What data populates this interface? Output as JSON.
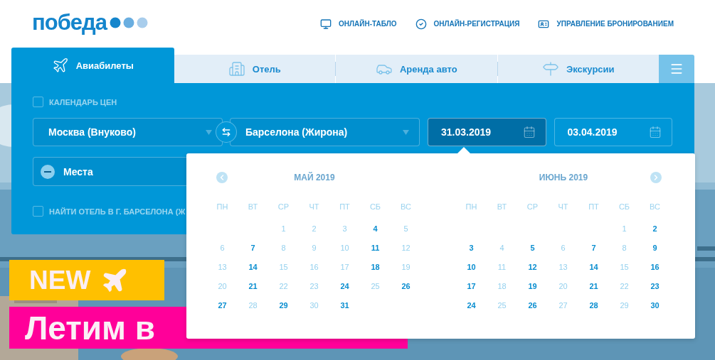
{
  "logo": {
    "text": "победа"
  },
  "nav": [
    {
      "label": "ОНЛАЙН-ТАБЛО"
    },
    {
      "label": "ОНЛАЙН-РЕГИСТРАЦИЯ"
    },
    {
      "label": "УПРАВЛЕНИЕ БРОНИРОВАНИЕМ"
    }
  ],
  "tabs": [
    {
      "label": "Авиабилеты",
      "selected": true
    },
    {
      "label": "Отель",
      "selected": false
    },
    {
      "label": "Аренда авто",
      "selected": false
    },
    {
      "label": "Экскурсии",
      "selected": false
    }
  ],
  "form": {
    "price_calendar": {
      "label": "КАЛЕНДАРЬ ЦЕН",
      "checked": false
    },
    "from": {
      "value": "Москва (Внуково)"
    },
    "to": {
      "value": "Барселона (Жирона)"
    },
    "dates": [
      {
        "value": "31.03.2019",
        "selected": true
      },
      {
        "value": "03.04.2019",
        "selected": false
      }
    ],
    "passengers": {
      "label": "Места"
    },
    "hotel": {
      "label": "НАЙТИ ОТЕЛЬ В Г. БАРСЕЛОНА (Ж",
      "checked": false
    }
  },
  "calendar": {
    "months": [
      {
        "title": "МАЙ 2019",
        "weekdays": [
          "ПН",
          "ВТ",
          "СР",
          "ЧТ",
          "ПТ",
          "СБ",
          "ВС"
        ],
        "weeks": [
          [
            {
              "kind": "blank"
            },
            {
              "kind": "blank"
            },
            {
              "kind": "day",
              "label": "1",
              "available": false
            },
            {
              "kind": "day",
              "label": "2",
              "available": false
            },
            {
              "kind": "day",
              "label": "3",
              "available": false
            },
            {
              "kind": "day",
              "label": "4",
              "available": true
            },
            {
              "kind": "day",
              "label": "5",
              "available": false
            }
          ],
          [
            {
              "kind": "day",
              "label": "6",
              "available": false
            },
            {
              "kind": "day",
              "label": "7",
              "available": true
            },
            {
              "kind": "day",
              "label": "8",
              "available": false
            },
            {
              "kind": "day",
              "label": "9",
              "available": false
            },
            {
              "kind": "day",
              "label": "10",
              "available": false
            },
            {
              "kind": "day",
              "label": "11",
              "available": true
            },
            {
              "kind": "day",
              "label": "12",
              "available": false
            }
          ],
          [
            {
              "kind": "day",
              "label": "13",
              "available": false
            },
            {
              "kind": "day",
              "label": "14",
              "available": true
            },
            {
              "kind": "day",
              "label": "15",
              "available": false
            },
            {
              "kind": "day",
              "label": "16",
              "available": false
            },
            {
              "kind": "day",
              "label": "17",
              "available": false
            },
            {
              "kind": "day",
              "label": "18",
              "available": true
            },
            {
              "kind": "day",
              "label": "19",
              "available": false
            }
          ],
          [
            {
              "kind": "day",
              "label": "20",
              "available": false
            },
            {
              "kind": "day",
              "label": "21",
              "available": true
            },
            {
              "kind": "day",
              "label": "22",
              "available": false
            },
            {
              "kind": "day",
              "label": "23",
              "available": false
            },
            {
              "kind": "day",
              "label": "24",
              "available": true
            },
            {
              "kind": "day",
              "label": "25",
              "available": false
            },
            {
              "kind": "day",
              "label": "26",
              "available": true
            }
          ],
          [
            {
              "kind": "day",
              "label": "27",
              "available": true
            },
            {
              "kind": "day",
              "label": "28",
              "available": false
            },
            {
              "kind": "day",
              "label": "29",
              "available": true
            },
            {
              "kind": "day",
              "label": "30",
              "available": false
            },
            {
              "kind": "day",
              "label": "31",
              "available": true
            },
            {
              "kind": "blank"
            },
            {
              "kind": "blank"
            }
          ]
        ]
      },
      {
        "title": "ИЮНЬ 2019",
        "weekdays": [
          "ПН",
          "ВТ",
          "СР",
          "ЧТ",
          "ПТ",
          "СБ",
          "ВС"
        ],
        "weeks": [
          [
            {
              "kind": "blank"
            },
            {
              "kind": "blank"
            },
            {
              "kind": "blank"
            },
            {
              "kind": "blank"
            },
            {
              "kind": "blank"
            },
            {
              "kind": "day",
              "label": "1",
              "available": false
            },
            {
              "kind": "day",
              "label": "2",
              "available": true
            }
          ],
          [
            {
              "kind": "day",
              "label": "3",
              "available": true
            },
            {
              "kind": "day",
              "label": "4",
              "available": false
            },
            {
              "kind": "day",
              "label": "5",
              "available": true
            },
            {
              "kind": "day",
              "label": "6",
              "available": false
            },
            {
              "kind": "day",
              "label": "7",
              "available": true
            },
            {
              "kind": "day",
              "label": "8",
              "available": false
            },
            {
              "kind": "day",
              "label": "9",
              "available": true
            }
          ],
          [
            {
              "kind": "day",
              "label": "10",
              "available": true
            },
            {
              "kind": "day",
              "label": "11",
              "available": false
            },
            {
              "kind": "day",
              "label": "12",
              "available": true
            },
            {
              "kind": "day",
              "label": "13",
              "available": false
            },
            {
              "kind": "day",
              "label": "14",
              "available": true
            },
            {
              "kind": "day",
              "label": "15",
              "available": false
            },
            {
              "kind": "day",
              "label": "16",
              "available": true
            }
          ],
          [
            {
              "kind": "day",
              "label": "17",
              "available": true
            },
            {
              "kind": "day",
              "label": "18",
              "available": false
            },
            {
              "kind": "day",
              "label": "19",
              "available": true
            },
            {
              "kind": "day",
              "label": "20",
              "available": false
            },
            {
              "kind": "day",
              "label": "21",
              "available": true
            },
            {
              "kind": "day",
              "label": "22",
              "available": false
            },
            {
              "kind": "day",
              "label": "23",
              "available": true
            }
          ],
          [
            {
              "kind": "day",
              "label": "24",
              "available": true
            },
            {
              "kind": "day",
              "label": "25",
              "available": false
            },
            {
              "kind": "day",
              "label": "26",
              "available": true
            },
            {
              "kind": "day",
              "label": "27",
              "available": false
            },
            {
              "kind": "day",
              "label": "28",
              "available": true
            },
            {
              "kind": "day",
              "label": "29",
              "available": false
            },
            {
              "kind": "day",
              "label": "30",
              "available": true
            }
          ]
        ]
      }
    ]
  },
  "banner": {
    "tag": "NEW",
    "headline": "Летим в"
  }
}
